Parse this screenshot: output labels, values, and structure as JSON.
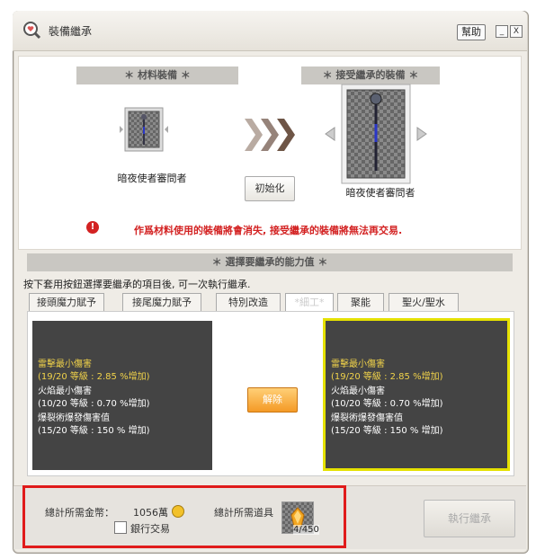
{
  "window": {
    "title": "裝備繼承",
    "help_label": "幫助",
    "minimize_label": "_",
    "close_label": "X"
  },
  "material": {
    "header": "＊ 材料裝備 ＊",
    "item_name": "暗夜使者審問者"
  },
  "target": {
    "header": "＊ 接受繼承的裝備 ＊",
    "item_name": "暗夜使者審問者"
  },
  "init_button": "初始化",
  "warning": "作爲材料使用的裝備將會消失, 接受繼承的裝備將無法再交易.",
  "ability": {
    "header": "＊ 選擇要繼承的能力值 ＊",
    "instruction": "按下套用按鈕選擇要繼承的項目後, 可一次執行繼承.",
    "tabs": [
      {
        "label": "接頭魔力賦予"
      },
      {
        "label": "接尾魔力賦予"
      },
      {
        "label": "特別改造"
      },
      {
        "label": "*細工*"
      },
      {
        "label": "聚能"
      },
      {
        "label": "聖火/聖水"
      }
    ],
    "left_lines": [
      "雷擊最小傷害",
      "(19/20 等級 : 2.85 %增加)",
      "火焰最小傷害",
      "(10/20 等級 : 0.70 %增加)",
      "爆裂術爆發傷害值",
      "(15/20 等級 : 150 % 增加)"
    ],
    "right_lines": [
      "雷擊最小傷害",
      "(19/20 等級 : 2.85 %增加)",
      "火焰最小傷害",
      "(10/20 等級 : 0.70 %增加)",
      "爆裂術爆發傷害值",
      "(15/20 等級 : 150 % 增加)"
    ],
    "release_button": "解除"
  },
  "footer": {
    "gold_label": "總計所需金幣：",
    "gold_value": "1056萬",
    "bank_trade_label": "銀行交易",
    "items_label": "總計所需道具",
    "item_count": "4/450",
    "execute_button": "執行繼承"
  },
  "colors": {
    "warning": "#d32222",
    "stat_highlight": "#f0d24a",
    "selected_outline": "#e5e100",
    "release_button": "#f49a26"
  },
  "icons": {
    "title": "magnifier-heart-icon",
    "coin": "gold-coin-icon",
    "warning": "warning-circle-icon"
  }
}
